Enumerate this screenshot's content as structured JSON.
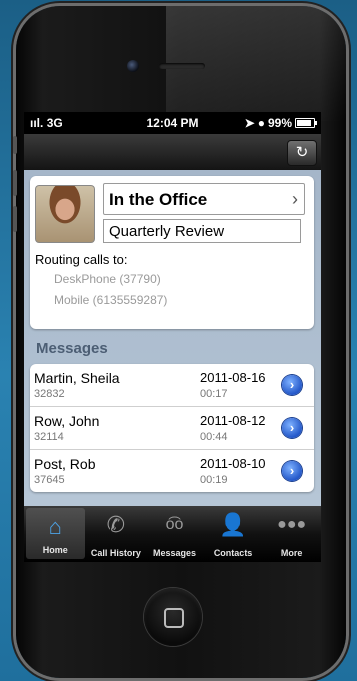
{
  "status_bar": {
    "carrier": "3G",
    "time": "12:04 PM",
    "battery": "99%"
  },
  "nav": {
    "refresh_icon": "refresh-icon"
  },
  "presence": {
    "status": "In the Office",
    "subject": "Quarterly Review",
    "routing_title": "Routing calls to:",
    "routes": [
      "DeskPhone (37790)",
      "Mobile (6135559287)"
    ]
  },
  "messages": {
    "title": "Messages",
    "items": [
      {
        "name": "Martin, Sheila",
        "ext": "32832",
        "date": "2011-08-16",
        "duration": "00:17"
      },
      {
        "name": "Row, John",
        "ext": "32114",
        "date": "2011-08-12",
        "duration": "00:44"
      },
      {
        "name": "Post, Rob",
        "ext": "37645",
        "date": "2011-08-10",
        "duration": "00:19"
      }
    ]
  },
  "tabs": [
    {
      "label": "Home",
      "icon": "home-icon"
    },
    {
      "label": "Call History",
      "icon": "phone-history-icon"
    },
    {
      "label": "Messages",
      "icon": "voicemail-icon"
    },
    {
      "label": "Contacts",
      "icon": "person-icon"
    },
    {
      "label": "More",
      "icon": "more-icon"
    }
  ],
  "colors": {
    "accent": "#4da3e6",
    "section_title": "#4c5e74",
    "disclosure": "#2458c9"
  }
}
